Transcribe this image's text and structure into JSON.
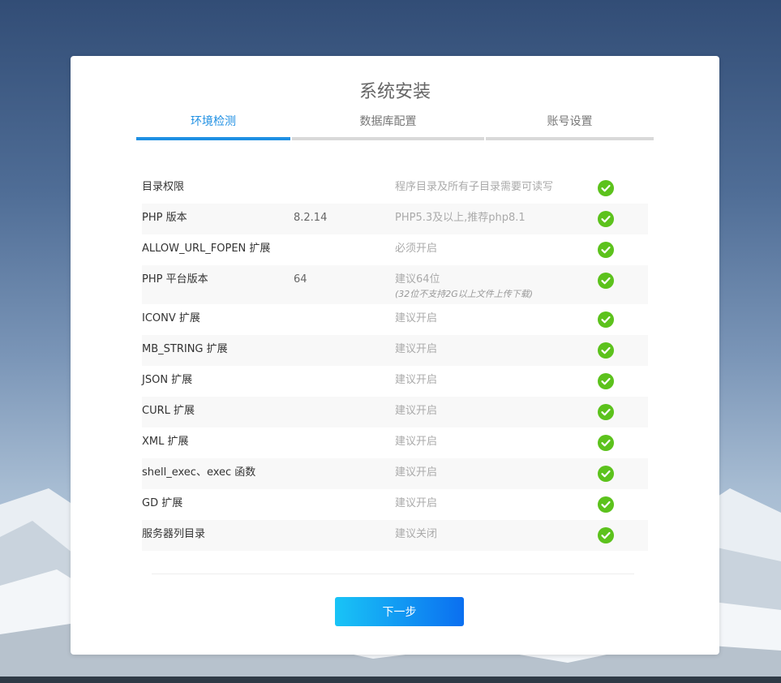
{
  "installer": {
    "title": "系统安装",
    "steps": [
      {
        "label": "环境检测",
        "active": true
      },
      {
        "label": "数据库配置",
        "active": false
      },
      {
        "label": "账号设置",
        "active": false
      }
    ],
    "checks": [
      {
        "name": "目录权限",
        "value": "",
        "requirement": "程序目录及所有子目录需要可读写",
        "note": "",
        "status": "pass"
      },
      {
        "name": "PHP 版本",
        "value": "8.2.14",
        "requirement": "PHP5.3及以上,推荐php8.1",
        "note": "",
        "status": "pass"
      },
      {
        "name": "ALLOW_URL_FOPEN 扩展",
        "value": "",
        "requirement": "必须开启",
        "note": "",
        "status": "pass"
      },
      {
        "name": "PHP 平台版本",
        "value": "64",
        "requirement": "建议64位",
        "note": "(32位不支持2G以上文件上传下载)",
        "status": "pass"
      },
      {
        "name": "ICONV 扩展",
        "value": "",
        "requirement": "建议开启",
        "note": "",
        "status": "pass"
      },
      {
        "name": "MB_STRING 扩展",
        "value": "",
        "requirement": "建议开启",
        "note": "",
        "status": "pass"
      },
      {
        "name": "JSON 扩展",
        "value": "",
        "requirement": "建议开启",
        "note": "",
        "status": "pass"
      },
      {
        "name": "CURL 扩展",
        "value": "",
        "requirement": "建议开启",
        "note": "",
        "status": "pass"
      },
      {
        "name": "XML 扩展",
        "value": "",
        "requirement": "建议开启",
        "note": "",
        "status": "pass"
      },
      {
        "name": "shell_exec、exec 函数",
        "value": "",
        "requirement": "建议开启",
        "note": "",
        "status": "pass"
      },
      {
        "name": "GD 扩展",
        "value": "",
        "requirement": "建议开启",
        "note": "",
        "status": "pass"
      },
      {
        "name": "服务器列目录",
        "value": "",
        "requirement": "建议关闭",
        "note": "",
        "status": "pass"
      }
    ],
    "next_label": "下一步"
  },
  "colors": {
    "accent": "#1e8fe3",
    "pass": "#5cc21c",
    "button_start": "#19c4f6",
    "button_end": "#0b6ff0"
  },
  "icons": {
    "status_pass": "check-circle-icon"
  }
}
